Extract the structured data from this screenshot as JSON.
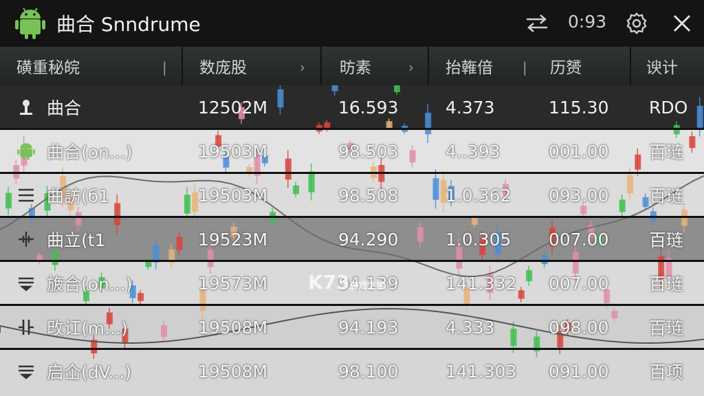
{
  "topbar": {
    "app_icon": "android-icon",
    "title": "曲合 Snndrume",
    "sync_icon": "swap-arrows-icon",
    "time": "0:93",
    "settings_icon": "gear-icon",
    "close_icon": "close-icon"
  },
  "columns": [
    "磺重秘皖",
    "数庞股",
    "昉素",
    "抬雗偣",
    "历赟",
    "谀计"
  ],
  "rows": [
    {
      "icon": "person-icon",
      "name": "曲合",
      "c1": "12502M",
      "c2": "16.593",
      "c3": "4.373",
      "c4": "115.30",
      "c5": "RDO"
    },
    {
      "icon": "android-icon",
      "name": "曲合(on...)",
      "c1": "19503M",
      "c2": "98.503",
      "c3": "4..393",
      "c4": "001.00",
      "c5": "百琏"
    },
    {
      "icon": "menu-lines-icon",
      "name": "曲訪(б1",
      "c1": "19503M",
      "c2": "98.508",
      "c3": "1.0.362",
      "c4": "093.00",
      "c5": "百琏"
    },
    {
      "icon": "split-plus-icon",
      "name": "曲立(t1",
      "c1": "19523M",
      "c2": "94.290",
      "c3": "1.0.305",
      "c4": "007.00",
      "c5": "百琏"
    },
    {
      "icon": "filter-lines-icon",
      "name": "旇合(on...)",
      "c1": "19573M",
      "c2": "94.139",
      "c3": "141.332",
      "c4": "007.00",
      "c5": "百琏"
    },
    {
      "icon": "split-bars-icon",
      "name": "攺讧(m...)",
      "c1": "19508M",
      "c2": "94.193",
      "c3": "4.333",
      "c4": "098.00",
      "c5": "百琏"
    },
    {
      "icon": "filter-lines-icon",
      "name": "启仚(dV...)",
      "c1": "19508M",
      "c2": "98.100",
      "c3": "141.303",
      "c4": "091.00",
      "c5": "百项"
    }
  ],
  "watermark": {
    "main": "K73",
    "sub": "游戏之家"
  },
  "colors": {
    "green": "#3fbf4f",
    "red": "#d9443b",
    "pink": "#e08fa8",
    "blue": "#4a8fd8",
    "android": "#78c257"
  }
}
